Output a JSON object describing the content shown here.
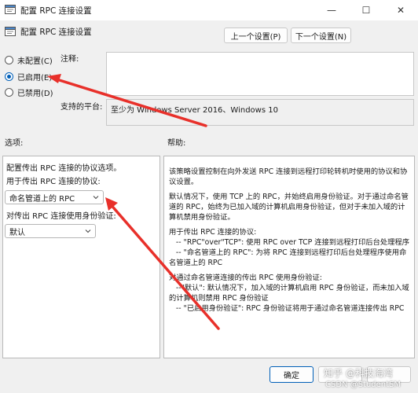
{
  "window": {
    "title": "配置 RPC 连接设置",
    "controls": {
      "minimize": "—",
      "maximize": "☐",
      "close": "✕"
    }
  },
  "header": {
    "title": "配置 RPC 连接设置",
    "prev_button": "上一个设置(P)",
    "next_button": "下一个设置(N)"
  },
  "state": {
    "options": [
      {
        "label": "未配置(C)",
        "checked": false
      },
      {
        "label": "已启用(E)",
        "checked": true
      },
      {
        "label": "已禁用(D)",
        "checked": false
      }
    ]
  },
  "comment": {
    "label": "注释:",
    "value": ""
  },
  "supported": {
    "label": "支持的平台:",
    "value": "至少为 Windows Server 2016、Windows 10"
  },
  "options_section": {
    "label": "选项:",
    "intro": "配置传出 RPC 连接的协议选项。",
    "protocol_label": "用于传出 RPC 连接的协议:",
    "protocol_value": "命名管道上的 RPC",
    "auth_label": "对传出 RPC 连接使用身份验证:",
    "auth_value": "默认"
  },
  "help_section": {
    "label": "帮助:",
    "paragraphs": [
      "该策略设置控制在向外发送 RPC 连接到远程打印轮转机时使用的协议和协议设置。",
      "默认情况下，使用 TCP 上的 RPC，并始终启用身份验证。对于通过命名管道的 RPC，始终为已加入域的计算机启用身份验证，但对于未加入域的计算机禁用身份验证。",
      "用于传出 RPC 连接的协议:\n   -- \"RPC\"over\"TCP\": 使用 RPC over TCP 连接到远程打印后台处理程序\n   -- \"命名管道上的 RPC\": 为将 RPC 连接到远程打印后台处理程序使用命名管道上的 RPC",
      "对通过命名管道连接的传出 RPC 使用身份验证:\n   --\"默认\": 默认情况下，加入域的计算机启用 RPC 身份验证，而未加入域的计算机则禁用 RPC 身份验证\n   -- \"已启用身份验证\": RPC 身份验证将用于通过命名管道连接传出 RPC"
    ]
  },
  "footer": {
    "ok_button": "确定",
    "watermark_1": "知乎 @科技海湾",
    "watermark_2": "CSDN @StudentSM"
  },
  "colors": {
    "accent": "#005fb8",
    "annotation_arrow": "#e8302a"
  }
}
